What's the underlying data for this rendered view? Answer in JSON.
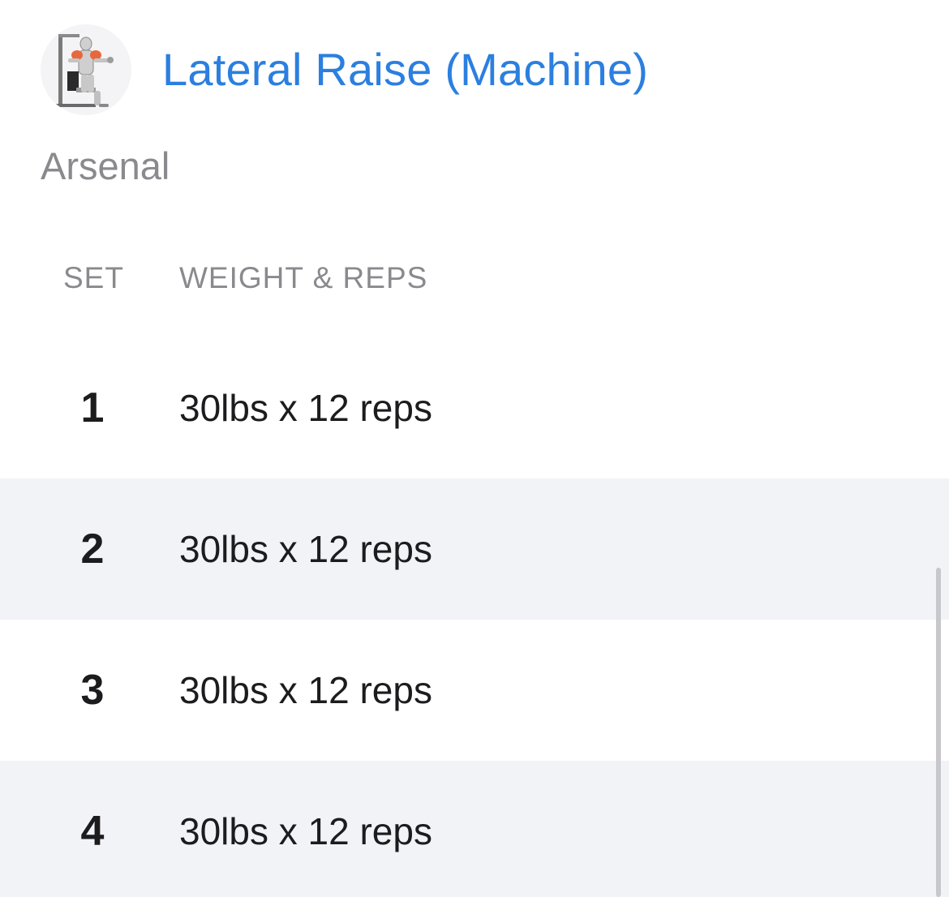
{
  "exercise": {
    "title": "Lateral Raise (Machine)",
    "subtitle": "Arsenal",
    "thumbnail_icon": "lateral-raise-machine-illustration",
    "title_color": "#2b7fe0"
  },
  "table": {
    "headers": {
      "set": "SET",
      "weight_reps": "WEIGHT & REPS"
    },
    "rows": [
      {
        "set": "1",
        "weight_reps": "30lbs x 12 reps"
      },
      {
        "set": "2",
        "weight_reps": "30lbs x 12 reps"
      },
      {
        "set": "3",
        "weight_reps": "30lbs x 12 reps"
      },
      {
        "set": "4",
        "weight_reps": "30lbs x 12 reps"
      }
    ]
  }
}
